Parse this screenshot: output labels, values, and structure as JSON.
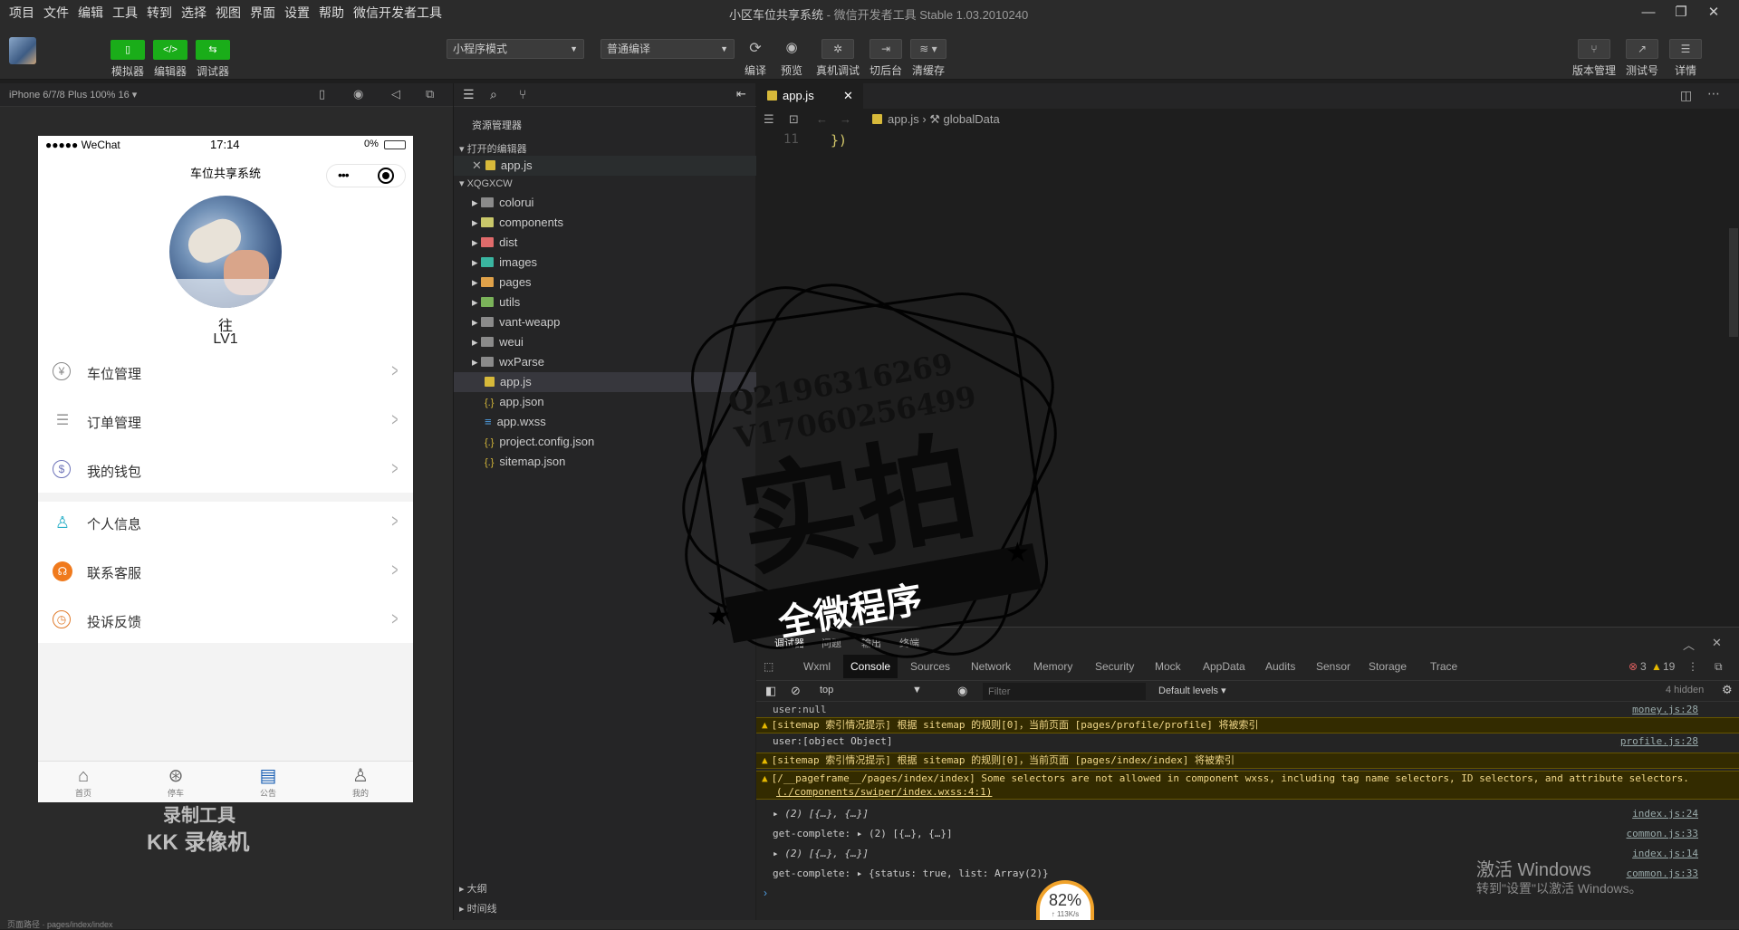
{
  "menu": [
    "项目",
    "文件",
    "编辑",
    "工具",
    "转到",
    "选择",
    "视图",
    "界面",
    "设置",
    "帮助",
    "微信开发者工具"
  ],
  "window": {
    "title": "小区车位共享系统",
    "subtitle": "- 微信开发者工具 Stable 1.03.2010240"
  },
  "toolbar": {
    "simulator": "模拟器",
    "editor": "编辑器",
    "debugger": "调试器",
    "mode_select": "小程序模式",
    "compile_select": "普通编译",
    "compile": "编译",
    "preview": "预览",
    "real_debug": "真机调试",
    "background": "切后台",
    "clear_cache": "清缓存",
    "version": "版本管理",
    "test_id": "测试号",
    "details": "详情"
  },
  "simulator": {
    "device": "iPhone 6/7/8 Plus 100% 16 ▾",
    "status_left": "●●●●● WeChat",
    "status_time": "17:14",
    "status_right": "0%",
    "nav_title": "车位共享系统",
    "user_name": "往",
    "user_level": "LV1",
    "menu_items": [
      "车位管理",
      "订单管理",
      "我的钱包",
      "个人信息",
      "联系客服",
      "投诉反馈"
    ],
    "tabs": [
      "首页",
      "停车",
      "公告",
      "我的"
    ]
  },
  "explorer": {
    "title": "资源管理器",
    "open_editors": "打开的编辑器",
    "open_file": "app.js",
    "project": "XQGXCW",
    "folders": [
      "colorui",
      "components",
      "dist",
      "images",
      "pages",
      "utils",
      "vant-weapp",
      "weui",
      "wxParse"
    ],
    "files": [
      "app.js",
      "app.json",
      "app.wxss",
      "project.config.json",
      "sitemap.json"
    ],
    "outline": "大纲",
    "timeline": "时间线"
  },
  "editor": {
    "tab": "app.js",
    "breadcrumb_file": "app.js",
    "breadcrumb_symbol": "globalData",
    "line_number": "11",
    "code": "})"
  },
  "devtools": {
    "tabs": [
      "调试器",
      "问题",
      "输出",
      "终端"
    ],
    "panels": [
      "Wxml",
      "Console",
      "Sources",
      "Network",
      "Memory",
      "Security",
      "Mock",
      "AppData",
      "Audits",
      "Sensor",
      "Storage",
      "Trace"
    ],
    "error_count": "3",
    "warn_count": "19",
    "context": "top",
    "filter_placeholder": "Filter",
    "levels": "Default levels ▾",
    "hidden": "4 hidden",
    "lines": [
      {
        "text": "user:null",
        "src": "money.js:28",
        "warn": false
      },
      {
        "text": "[sitemap 索引情况提示] 根据 sitemap 的规则[0]，当前页面 [pages/profile/profile] 将被索引",
        "src": "",
        "warn": true
      },
      {
        "text": "user:[object Object]",
        "src": "profile.js:28",
        "warn": false
      },
      {
        "text": "[sitemap 索引情况提示] 根据 sitemap 的规则[0]，当前页面 [pages/index/index] 将被索引",
        "src": "",
        "warn": true
      },
      {
        "text": "[/__pageframe__/pages/index/index] Some selectors are not allowed in component wxss, including tag name selectors, ID selectors, and attribute selectors.",
        "text2": "(./components/swiper/index.wxss:4:1)",
        "src": "",
        "warn": true
      },
      {
        "text": "▸ (2) [{…}, {…}]",
        "src": "index.js:24",
        "warn": false
      },
      {
        "text": "get-complete: ▸ (2) [{…}, {…}]",
        "src": "common.js:33",
        "warn": false
      },
      {
        "text": "▸ (2) [{…}, {…}]",
        "src": "index.js:14",
        "warn": false
      },
      {
        "text": "get-complete: ▸ {status: true, list: Array(2)}",
        "src": "common.js:33",
        "warn": false
      }
    ]
  },
  "watermarks": {
    "qq": "Q2196316269",
    "vx": "V17060256499",
    "big": "实拍",
    "ribbon": "全微程序",
    "rec1": "录制工具",
    "rec2": "KK 录像机",
    "win1": "激活 Windows",
    "win2": "转到\"设置\"以激活 Windows。",
    "gauge": "82%",
    "gauge_sub": "↑ 113K/s"
  },
  "status": {
    "left": "页面路径 · pages/index/index"
  }
}
